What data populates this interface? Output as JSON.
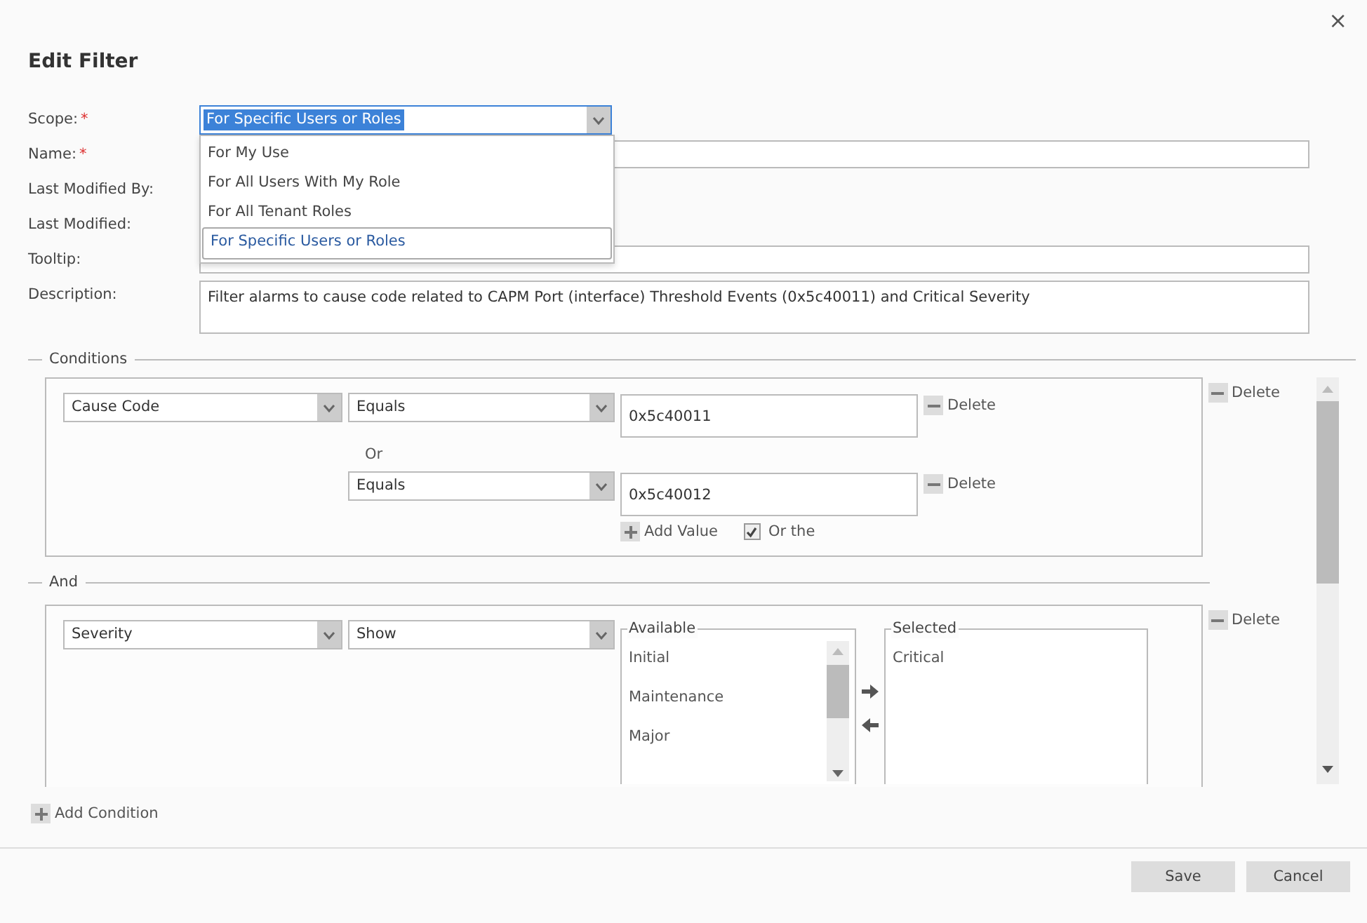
{
  "dialog": {
    "title": "Edit Filter",
    "close": "×"
  },
  "form": {
    "fields": [
      {
        "label": "Scope:",
        "marker": "*",
        "kind": "select",
        "value": "For Specific Users or Roles",
        "open": true,
        "options": [
          {
            "label": "For My Use",
            "selected": false
          },
          {
            "label": "For All Users With My Role",
            "selected": false
          },
          {
            "label": "For All Tenant Roles",
            "selected": false
          },
          {
            "label": "For Specific Users or Roles",
            "selected": true
          }
        ]
      },
      {
        "label": "Name:",
        "marker": "*",
        "kind": "text"
      },
      {
        "label": "Last Modified By:",
        "kind": "static"
      },
      {
        "label": "Last Modified:",
        "kind": "static"
      },
      {
        "label": "Tooltip:",
        "kind": "text"
      },
      {
        "label": "Description:",
        "kind": "textarea",
        "value": "Filter alarms to cause code related to CAPM Port (interface) Threshold Events (0x5c40011) and Critical Severity"
      }
    ]
  },
  "conditions": {
    "legend": "Conditions",
    "items": [
      {
        "kind": "values",
        "attribute": "Cause Code",
        "delete": "Delete",
        "values": [
          {
            "operator": "Equals",
            "value": "0x5c40011",
            "delete": "Delete"
          },
          {
            "operator": "Equals",
            "value": "0x5c40012",
            "delete": "Delete"
          }
        ],
        "or_label": "Or",
        "add_value": "Add Value",
        "or_the": {
          "label": "Or the",
          "checked": true
        }
      },
      {
        "kind": "list",
        "connector": "And",
        "attribute": "Severity",
        "operator": "Show",
        "delete": "Delete",
        "available": {
          "title": "Available",
          "items": [
            "Initial",
            "Maintenance",
            "Major"
          ]
        },
        "selected": {
          "title": "Selected",
          "items": [
            "Critical"
          ]
        }
      }
    ],
    "add_condition": "Add Condition"
  },
  "buttons": [
    "Save",
    "Cancel"
  ]
}
